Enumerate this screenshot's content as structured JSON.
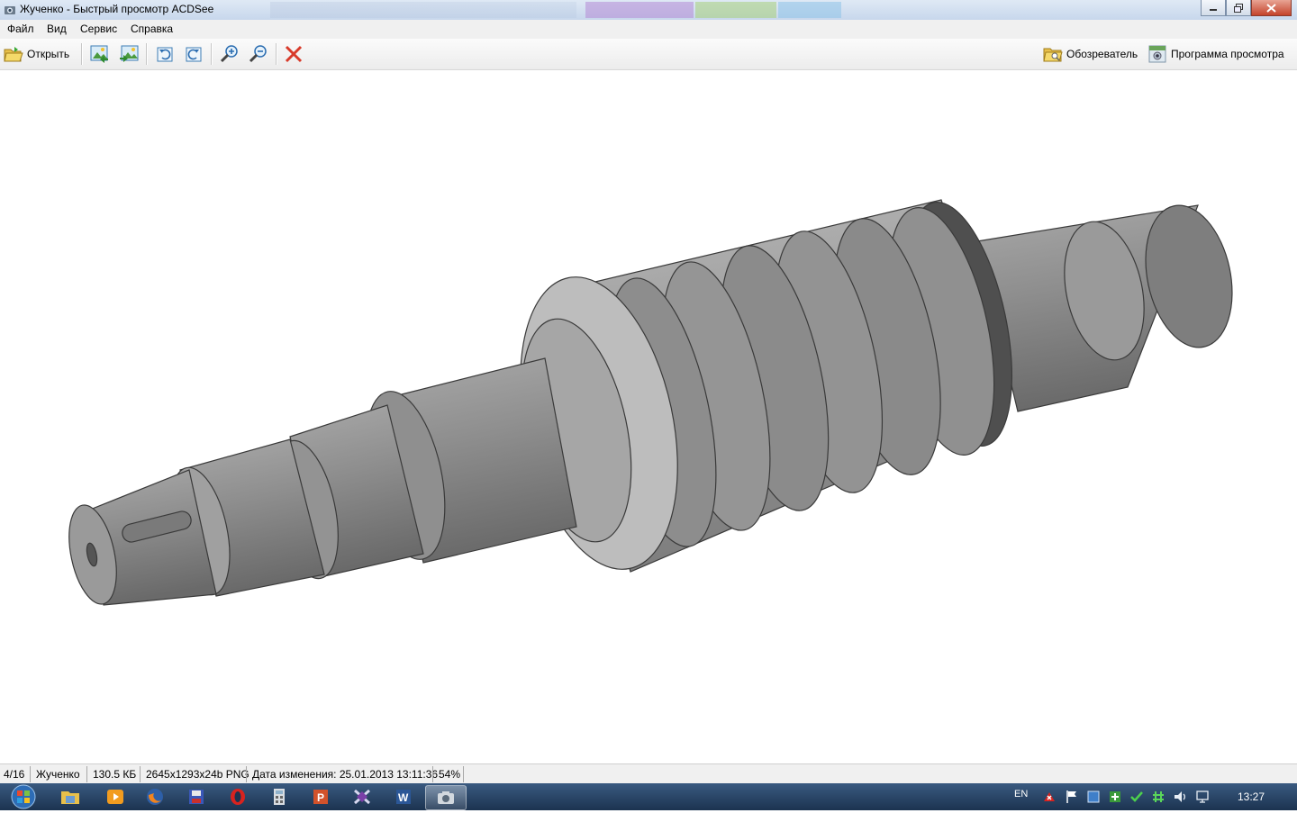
{
  "window": {
    "title": "Жученко - Быстрый просмотр ACDSee"
  },
  "menu": [
    "Файл",
    "Вид",
    "Сервис",
    "Справка"
  ],
  "toolbar": {
    "open_label": "Открыть",
    "browser_label": "Обозреватель",
    "viewer_label": "Программа просмотра"
  },
  "status": {
    "position": "4/16",
    "filename": "Жученко",
    "filesize": "130.5 КБ",
    "dimensions": "2645x1293x24b PNG",
    "modified": "Дата изменения: 25.01.2013 13:11:36",
    "zoom": "54%"
  },
  "taskbar": {
    "language": "EN",
    "time": "13:27"
  },
  "colors": {
    "part_light": "#b8b8b8",
    "part_mid": "#8c8c8c",
    "part_dark": "#5a5a5a",
    "outline": "#3a3a3a"
  }
}
